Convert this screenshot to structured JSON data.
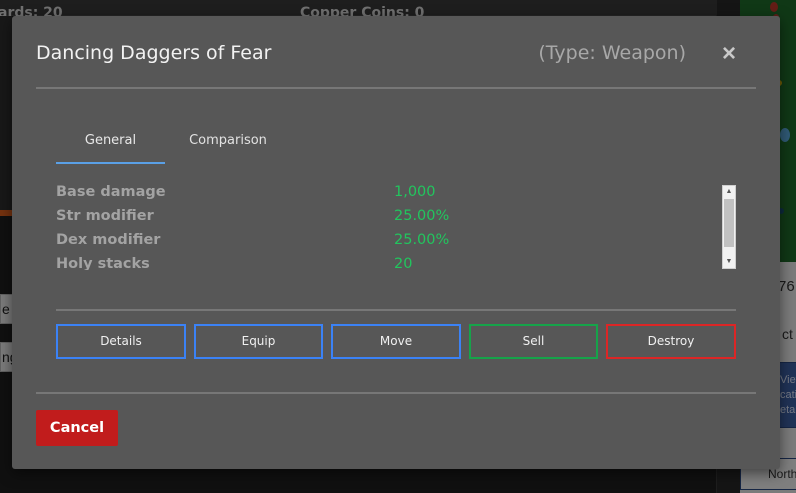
{
  "background": {
    "top_left_text": "ards: 20",
    "top_mid_text": "Copper Coins: 0",
    "left_buttons": [
      "e",
      "ng"
    ],
    "right_number": "76",
    "right_action": "ct",
    "right_blue_lines": [
      "View",
      "cati",
      "etai"
    ],
    "right_north": "North"
  },
  "modal": {
    "title": "Dancing Daggers of Fear",
    "type_label": "(Type: Weapon)",
    "close_symbol": "×",
    "tabs": [
      {
        "label": "General",
        "active": true
      },
      {
        "label": "Comparison",
        "active": false
      }
    ],
    "stats": [
      {
        "label": "Base damage",
        "value": "1,000"
      },
      {
        "label": "Str modifier",
        "value": "25.00%"
      },
      {
        "label": "Dex modifier",
        "value": "25.00%"
      },
      {
        "label": "Holy stacks",
        "value": "20"
      }
    ],
    "scrollbar": {
      "up_arrow": "▲",
      "down_arrow": "▼"
    },
    "actions": {
      "details": "Details",
      "equip": "Equip",
      "move": "Move",
      "sell": "Sell",
      "destroy": "Destroy"
    },
    "cancel_label": "Cancel"
  },
  "colors": {
    "modal_bg": "#575757",
    "stat_value": "#22c55e",
    "tab_active_underline": "#5aa0e6",
    "button_blue": "#3b82f6",
    "button_green": "#16a34a",
    "button_red": "#dc2626",
    "cancel_bg": "#c11c1c"
  }
}
